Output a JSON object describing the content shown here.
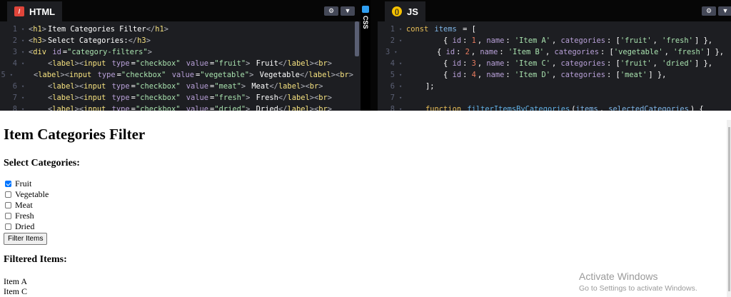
{
  "html_panel": {
    "tab_label": "HTML",
    "icon": "/",
    "line_numbers": [
      "1",
      "2",
      "3",
      "4",
      "5",
      "6",
      "7",
      "8"
    ],
    "lines": [
      [
        [
          "tag",
          "<"
        ],
        [
          "tname",
          "h1"
        ],
        [
          "tag",
          ">"
        ],
        [
          "txt",
          "Item Categories Filter"
        ],
        [
          "tag",
          "</"
        ],
        [
          "tname",
          "h1"
        ],
        [
          "tag",
          ">"
        ]
      ],
      [
        [
          "tag",
          "<"
        ],
        [
          "tname",
          "h3"
        ],
        [
          "tag",
          ">"
        ],
        [
          "txt",
          "Select Categories:"
        ],
        [
          "tag",
          "</"
        ],
        [
          "tname",
          "h3"
        ],
        [
          "tag",
          ">"
        ]
      ],
      [
        [
          "tag",
          "<"
        ],
        [
          "tname",
          "div"
        ],
        [
          "txt",
          " "
        ],
        [
          "attr",
          "id"
        ],
        [
          "txt",
          "="
        ],
        [
          "str",
          "\"category-filters\""
        ],
        [
          "tag",
          ">"
        ]
      ],
      [
        [
          "txt",
          "    "
        ],
        [
          "tag",
          "<"
        ],
        [
          "tname",
          "label"
        ],
        [
          "tag",
          "><"
        ],
        [
          "tname",
          "input"
        ],
        [
          "txt",
          " "
        ],
        [
          "attr",
          "type"
        ],
        [
          "txt",
          "="
        ],
        [
          "str",
          "\"checkbox\""
        ],
        [
          "txt",
          " "
        ],
        [
          "attr",
          "value"
        ],
        [
          "txt",
          "="
        ],
        [
          "str",
          "\"fruit\""
        ],
        [
          "tag",
          ">"
        ],
        [
          "txt",
          " Fruit"
        ],
        [
          "tag",
          "</"
        ],
        [
          "tname",
          "label"
        ],
        [
          "tag",
          "><"
        ],
        [
          "tname",
          "br"
        ],
        [
          "tag",
          ">"
        ]
      ],
      [
        [
          "txt",
          "    "
        ],
        [
          "tag",
          "<"
        ],
        [
          "tname",
          "label"
        ],
        [
          "tag",
          "><"
        ],
        [
          "tname",
          "input"
        ],
        [
          "txt",
          " "
        ],
        [
          "attr",
          "type"
        ],
        [
          "txt",
          "="
        ],
        [
          "str",
          "\"checkbox\""
        ],
        [
          "txt",
          " "
        ],
        [
          "attr",
          "value"
        ],
        [
          "txt",
          "="
        ],
        [
          "str",
          "\"vegetable\""
        ],
        [
          "tag",
          ">"
        ],
        [
          "txt",
          " Vegetable"
        ],
        [
          "tag",
          "</"
        ],
        [
          "tname",
          "label"
        ],
        [
          "tag",
          "><"
        ],
        [
          "tname",
          "br"
        ],
        [
          "tag",
          ">"
        ]
      ],
      [
        [
          "txt",
          "    "
        ],
        [
          "tag",
          "<"
        ],
        [
          "tname",
          "label"
        ],
        [
          "tag",
          "><"
        ],
        [
          "tname",
          "input"
        ],
        [
          "txt",
          " "
        ],
        [
          "attr",
          "type"
        ],
        [
          "txt",
          "="
        ],
        [
          "str",
          "\"checkbox\""
        ],
        [
          "txt",
          " "
        ],
        [
          "attr",
          "value"
        ],
        [
          "txt",
          "="
        ],
        [
          "str",
          "\"meat\""
        ],
        [
          "tag",
          ">"
        ],
        [
          "txt",
          " Meat"
        ],
        [
          "tag",
          "</"
        ],
        [
          "tname",
          "label"
        ],
        [
          "tag",
          "><"
        ],
        [
          "tname",
          "br"
        ],
        [
          "tag",
          ">"
        ]
      ],
      [
        [
          "txt",
          "    "
        ],
        [
          "tag",
          "<"
        ],
        [
          "tname",
          "label"
        ],
        [
          "tag",
          "><"
        ],
        [
          "tname",
          "input"
        ],
        [
          "txt",
          " "
        ],
        [
          "attr",
          "type"
        ],
        [
          "txt",
          "="
        ],
        [
          "str",
          "\"checkbox\""
        ],
        [
          "txt",
          " "
        ],
        [
          "attr",
          "value"
        ],
        [
          "txt",
          "="
        ],
        [
          "str",
          "\"fresh\""
        ],
        [
          "tag",
          ">"
        ],
        [
          "txt",
          " Fresh"
        ],
        [
          "tag",
          "</"
        ],
        [
          "tname",
          "label"
        ],
        [
          "tag",
          "><"
        ],
        [
          "tname",
          "br"
        ],
        [
          "tag",
          ">"
        ]
      ],
      [
        [
          "txt",
          "    "
        ],
        [
          "tag",
          "<"
        ],
        [
          "tname",
          "label"
        ],
        [
          "tag",
          "><"
        ],
        [
          "tname",
          "input"
        ],
        [
          "txt",
          " "
        ],
        [
          "attr",
          "type"
        ],
        [
          "txt",
          "="
        ],
        [
          "str",
          "\"checkbox\""
        ],
        [
          "txt",
          " "
        ],
        [
          "attr",
          "value"
        ],
        [
          "txt",
          "="
        ],
        [
          "str",
          "\"dried\""
        ],
        [
          "tag",
          ">"
        ],
        [
          "txt",
          " Dried"
        ],
        [
          "tag",
          "</"
        ],
        [
          "tname",
          "label"
        ],
        [
          "tag",
          "><"
        ],
        [
          "tname",
          "br"
        ],
        [
          "tag",
          ">"
        ]
      ]
    ]
  },
  "css_panel": {
    "label": "CSS"
  },
  "js_panel": {
    "tab_label": "JS",
    "icon": "()",
    "line_numbers": [
      "1",
      "2",
      "3",
      "4",
      "5",
      "6",
      "7",
      "8"
    ],
    "lines": [
      [
        [
          "kw",
          "const"
        ],
        [
          "txt",
          " "
        ],
        [
          "var",
          "items"
        ],
        [
          "txt",
          " = ["
        ]
      ],
      [
        [
          "txt",
          "        { "
        ],
        [
          "prop",
          "id"
        ],
        [
          "txt",
          ": "
        ],
        [
          "num",
          "1"
        ],
        [
          "txt",
          ", "
        ],
        [
          "prop",
          "name"
        ],
        [
          "txt",
          ": "
        ],
        [
          "str",
          "'Item A'"
        ],
        [
          "txt",
          ", "
        ],
        [
          "prop",
          "categories"
        ],
        [
          "txt",
          ": ["
        ],
        [
          "str",
          "'fruit'"
        ],
        [
          "txt",
          ", "
        ],
        [
          "str",
          "'fresh'"
        ],
        [
          "txt",
          "] },"
        ]
      ],
      [
        [
          "txt",
          "        { "
        ],
        [
          "prop",
          "id"
        ],
        [
          "txt",
          ": "
        ],
        [
          "num",
          "2"
        ],
        [
          "txt",
          ", "
        ],
        [
          "prop",
          "name"
        ],
        [
          "txt",
          ": "
        ],
        [
          "str",
          "'Item B'"
        ],
        [
          "txt",
          ", "
        ],
        [
          "prop",
          "categories"
        ],
        [
          "txt",
          ": ["
        ],
        [
          "str",
          "'vegetable'"
        ],
        [
          "txt",
          ", "
        ],
        [
          "str",
          "'fresh'"
        ],
        [
          "txt",
          "] },"
        ]
      ],
      [
        [
          "txt",
          "        { "
        ],
        [
          "prop",
          "id"
        ],
        [
          "txt",
          ": "
        ],
        [
          "num",
          "3"
        ],
        [
          "txt",
          ", "
        ],
        [
          "prop",
          "name"
        ],
        [
          "txt",
          ": "
        ],
        [
          "str",
          "'Item C'"
        ],
        [
          "txt",
          ", "
        ],
        [
          "prop",
          "categories"
        ],
        [
          "txt",
          ": ["
        ],
        [
          "str",
          "'fruit'"
        ],
        [
          "txt",
          ", "
        ],
        [
          "str",
          "'dried'"
        ],
        [
          "txt",
          "] },"
        ]
      ],
      [
        [
          "txt",
          "        { "
        ],
        [
          "prop",
          "id"
        ],
        [
          "txt",
          ": "
        ],
        [
          "num",
          "4"
        ],
        [
          "txt",
          ", "
        ],
        [
          "prop",
          "name"
        ],
        [
          "txt",
          ": "
        ],
        [
          "str",
          "'Item D'"
        ],
        [
          "txt",
          ", "
        ],
        [
          "prop",
          "categories"
        ],
        [
          "txt",
          ": ["
        ],
        [
          "str",
          "'meat'"
        ],
        [
          "txt",
          "] },"
        ]
      ],
      [
        [
          "txt",
          "    ];"
        ]
      ],
      [
        [
          "txt",
          ""
        ]
      ],
      [
        [
          "txt",
          "    "
        ],
        [
          "kw",
          "function"
        ],
        [
          "txt",
          " "
        ],
        [
          "fn",
          "filterItemsByCategories"
        ],
        [
          "txt",
          "("
        ],
        [
          "var",
          "items"
        ],
        [
          "txt",
          ", "
        ],
        [
          "var",
          "selectedCategories"
        ],
        [
          "txt",
          ") {"
        ]
      ]
    ]
  },
  "output": {
    "title": "Item Categories Filter",
    "select_heading": "Select Categories:",
    "checkboxes": [
      {
        "label": "Fruit",
        "checked": true
      },
      {
        "label": "Vegetable",
        "checked": false
      },
      {
        "label": "Meat",
        "checked": false
      },
      {
        "label": "Fresh",
        "checked": false
      },
      {
        "label": "Dried",
        "checked": false
      }
    ],
    "filter_button": "Filter Items",
    "filtered_heading": "Filtered Items:",
    "items": [
      "Item A",
      "Item C"
    ]
  },
  "watermark": {
    "title": "Activate Windows",
    "subtitle": "Go to Settings to activate Windows."
  },
  "icons": {
    "settings": "gear-icon",
    "collapse": "chevron-down-icon"
  },
  "colors": {
    "editor_bg": "#1d1e22",
    "header_bg": "#060606",
    "checkbox_accent": "#0075ff"
  }
}
